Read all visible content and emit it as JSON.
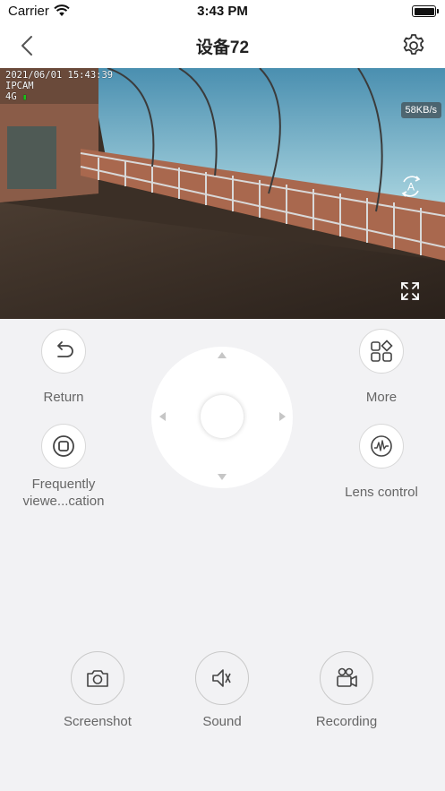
{
  "status": {
    "carrier": "Carrier",
    "time": "3:43 PM"
  },
  "nav": {
    "title": "设备72"
  },
  "video": {
    "osd_date": "2021/06/01 15:43:39",
    "osd_name": "IPCAM",
    "osd_network": "4G",
    "bitrate": "58KB/s",
    "auto_label": "A"
  },
  "controls": {
    "return_label": "Return",
    "more_label": "More",
    "frequently_label": "Frequently viewe...cation",
    "lens_label": "Lens control"
  },
  "actions": {
    "screenshot_label": "Screenshot",
    "sound_label": "Sound",
    "recording_label": "Recording"
  },
  "colors": {
    "accent": "#222222",
    "signal": "#19c419",
    "panel": "#f2f2f4"
  }
}
